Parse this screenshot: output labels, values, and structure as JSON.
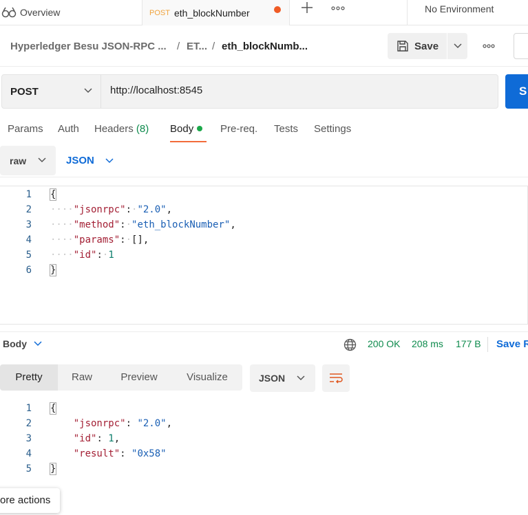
{
  "tabs": {
    "overview_label": "Overview",
    "active_method": "POST",
    "active_title": "eth_blockNumber",
    "environment": "No Environment"
  },
  "breadcrumb": {
    "collection": "Hyperledger Besu JSON-RPC ...",
    "folder": "ET...",
    "request": "eth_blockNumb...",
    "separator": "/"
  },
  "toolbar": {
    "save_label": "Save"
  },
  "request": {
    "method": "POST",
    "url": "http://localhost:8545",
    "send_label": "S"
  },
  "req_tabs": {
    "params": "Params",
    "auth": "Auth",
    "headers": "Headers",
    "headers_count": "(8)",
    "body": "Body",
    "prereq": "Pre-req.",
    "tests": "Tests",
    "settings": "Settings"
  },
  "body_type": {
    "mode": "raw",
    "language": "JSON"
  },
  "request_body": {
    "line_numbers": [
      "1",
      "2",
      "3",
      "4",
      "5",
      "6"
    ],
    "open_brace": "{",
    "close_brace": "}",
    "key_jsonrpc": "\"jsonrpc\"",
    "val_jsonrpc": "\"2.0\"",
    "key_method": "\"method\"",
    "val_method": "\"eth_blockNumber\"",
    "key_params": "\"params\"",
    "val_params": "[]",
    "key_id": "\"id\"",
    "val_id": "1"
  },
  "response": {
    "section_label": "Body",
    "status": "200 OK",
    "time": "208 ms",
    "size": "177 B",
    "save_label": "Save R"
  },
  "response_view": {
    "pretty": "Pretty",
    "raw": "Raw",
    "preview": "Preview",
    "visualize": "Visualize",
    "format": "JSON"
  },
  "response_body": {
    "line_numbers": [
      "1",
      "2",
      "3",
      "4",
      "5"
    ],
    "open_brace": "{",
    "close_brace": "}",
    "key_jsonrpc": "\"jsonrpc\"",
    "val_jsonrpc": "\"2.0\"",
    "key_id": "\"id\"",
    "val_id": "1",
    "key_result": "\"result\"",
    "val_result": "\"0x58\""
  },
  "tooltip": {
    "text": "ore actions"
  },
  "colors": {
    "accent_blue": "#0f6bd7",
    "status_green": "#0d8a4c",
    "unsaved_orange": "#ef5b25",
    "post_method": "#f0a33c"
  }
}
